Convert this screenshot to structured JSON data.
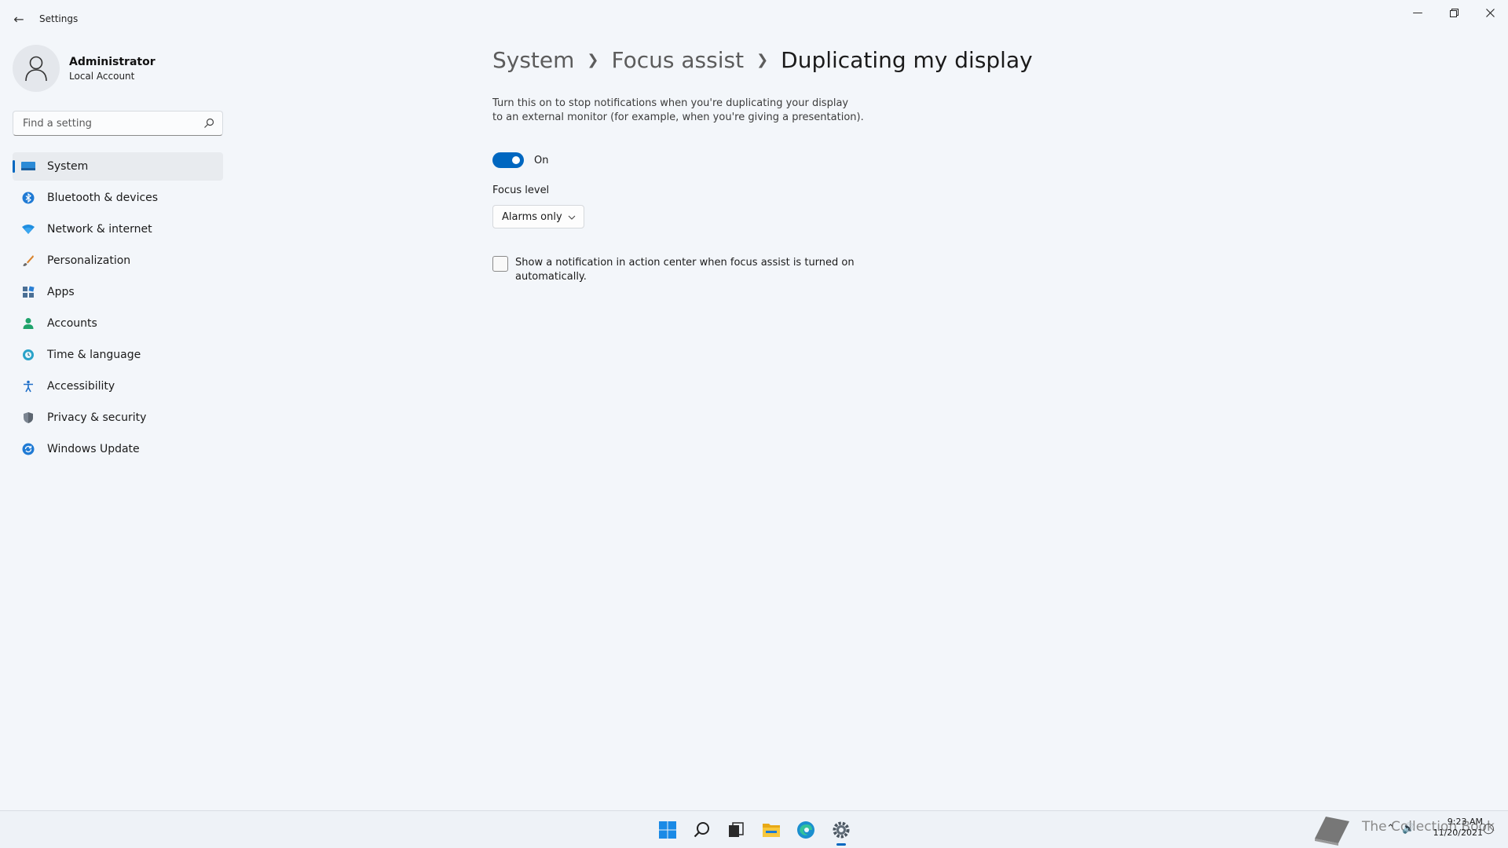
{
  "window": {
    "title": "Settings",
    "controls": [
      "minimize",
      "restore",
      "close"
    ]
  },
  "profile": {
    "name": "Administrator",
    "account_type": "Local Account"
  },
  "search": {
    "placeholder": "Find a setting"
  },
  "sidebar": {
    "items": [
      {
        "label": "System",
        "icon": "monitor-icon",
        "active": true
      },
      {
        "label": "Bluetooth & devices",
        "icon": "bluetooth-icon"
      },
      {
        "label": "Network & internet",
        "icon": "wifi-icon"
      },
      {
        "label": "Personalization",
        "icon": "brush-icon"
      },
      {
        "label": "Apps",
        "icon": "apps-icon"
      },
      {
        "label": "Accounts",
        "icon": "person-icon"
      },
      {
        "label": "Time & language",
        "icon": "globe-clock-icon"
      },
      {
        "label": "Accessibility",
        "icon": "accessibility-icon"
      },
      {
        "label": "Privacy & security",
        "icon": "shield-icon"
      },
      {
        "label": "Windows Update",
        "icon": "update-icon"
      }
    ]
  },
  "breadcrumb": {
    "items": [
      "System",
      "Focus assist",
      "Duplicating my display"
    ]
  },
  "main": {
    "description_line1": "Turn this on to stop notifications when you're duplicating your display",
    "description_line2": "to an external monitor (for example, when you're giving a presentation).",
    "toggle": {
      "state": "On",
      "enabled": true
    },
    "focus_level_label": "Focus level",
    "focus_level_value": "Alarms only",
    "checkbox": {
      "checked": false,
      "line1": "Show a notification in action center when focus assist is turned on",
      "line2": "automatically."
    }
  },
  "taskbar": {
    "icons": [
      "start-icon",
      "search-icon",
      "task-view-icon",
      "file-explorer-icon",
      "edge-icon",
      "settings-icon"
    ],
    "watermark": "The Collection Book",
    "time": "9:23 AM",
    "date": "11/20/2021"
  },
  "colors": {
    "accent": "#0067c0",
    "background": "#f3f6fa"
  }
}
